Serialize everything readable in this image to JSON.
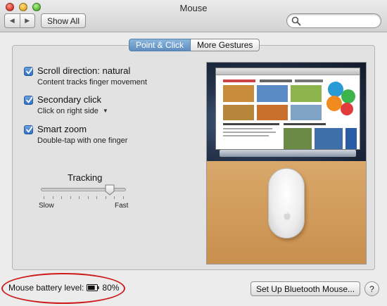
{
  "window": {
    "title": "Mouse"
  },
  "toolbar": {
    "back_icon": "chevron-left-icon",
    "forward_icon": "chevron-right-icon",
    "show_all_label": "Show All",
    "search_placeholder": "",
    "search_icon": "search-icon"
  },
  "tabs": [
    {
      "label": "Point & Click",
      "active": true
    },
    {
      "label": "More Gestures",
      "active": false
    }
  ],
  "options": [
    {
      "title": "Scroll direction: natural",
      "description": "Content tracks finger movement",
      "checked": true
    },
    {
      "title": "Secondary click",
      "description": "Click on right side",
      "checked": true,
      "has_dropdown": true
    },
    {
      "title": "Smart zoom",
      "description": "Double-tap with one finger",
      "checked": true
    }
  ],
  "tracking": {
    "label": "Tracking",
    "min_label": "Slow",
    "max_label": "Fast",
    "value_fraction": 0.85,
    "tick_count": 10
  },
  "footer": {
    "battery_label": "Mouse battery level:",
    "battery_value": "80%",
    "battery_fraction": 0.8,
    "setup_button_label": "Set Up Bluetooth Mouse...",
    "help_label": "?"
  },
  "colors": {
    "accent": "#5e8ec0",
    "highlight": "#cc1a1a"
  }
}
